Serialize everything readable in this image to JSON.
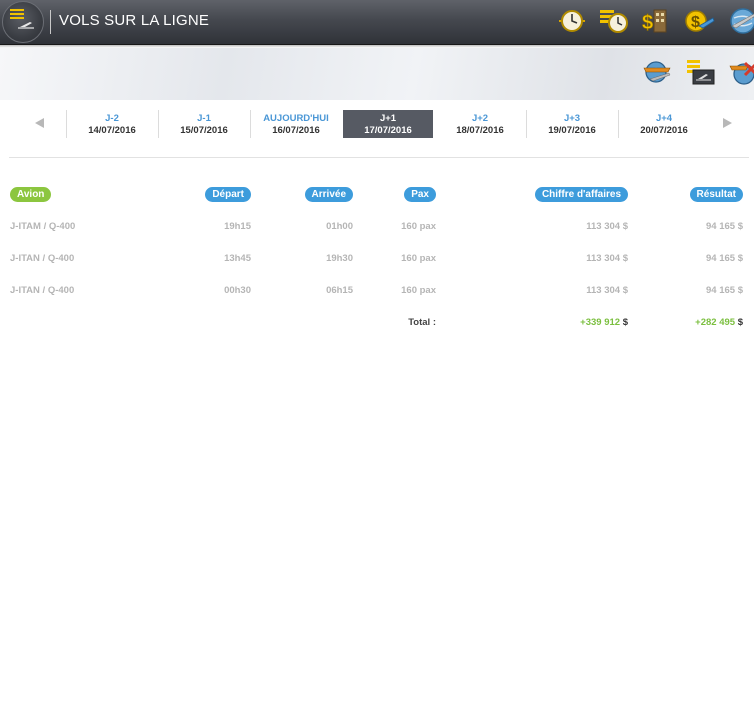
{
  "header": {
    "title": "VOLS SUR LA LIGNE",
    "icons": [
      "menu-icon",
      "clock-icon",
      "schedule-clock-icon",
      "money-building-icon",
      "money-plane-icon",
      "globe-plane-icon"
    ]
  },
  "toolbar": {
    "icons": [
      "globe-flight-icon",
      "flight-list-icon",
      "cancel-flight-icon"
    ]
  },
  "date_nav": {
    "days": [
      {
        "label": "J-2",
        "date": "14/07/2016",
        "active": false
      },
      {
        "label": "J-1",
        "date": "15/07/2016",
        "active": false
      },
      {
        "label": "AUJOURD'HUI",
        "date": "16/07/2016",
        "active": false
      },
      {
        "label": "J+1",
        "date": "17/07/2016",
        "active": true
      },
      {
        "label": "J+2",
        "date": "18/07/2016",
        "active": false
      },
      {
        "label": "J+3",
        "date": "19/07/2016",
        "active": false
      },
      {
        "label": "J+4",
        "date": "20/07/2016",
        "active": false
      }
    ]
  },
  "table": {
    "headers": {
      "avion": "Avion",
      "depart": "Départ",
      "arrivee": "Arrivée",
      "pax": "Pax",
      "ca": "Chiffre d'affaires",
      "resultat": "Résultat"
    },
    "rows": [
      {
        "avion": "J-ITAM / Q-400",
        "depart": "19h15",
        "arrivee": "01h00",
        "pax": "160 pax",
        "ca": "113 304 $",
        "resultat": "94 165 $"
      },
      {
        "avion": "J-ITAN / Q-400",
        "depart": "13h45",
        "arrivee": "19h30",
        "pax": "160 pax",
        "ca": "113 304 $",
        "resultat": "94 165 $"
      },
      {
        "avion": "J-ITAN / Q-400",
        "depart": "00h30",
        "arrivee": "06h15",
        "pax": "160 pax",
        "ca": "113 304 $",
        "resultat": "94 165 $"
      }
    ],
    "total": {
      "label": "Total :",
      "ca_value": "+339 912",
      "ca_currency": "$",
      "resultat_value": "+282 495",
      "resultat_currency": "$"
    }
  },
  "colors": {
    "header": "#45484f",
    "accent_blue": "#3d9cdc",
    "accent_green": "#8cc63f",
    "gold": "#f2c200"
  }
}
